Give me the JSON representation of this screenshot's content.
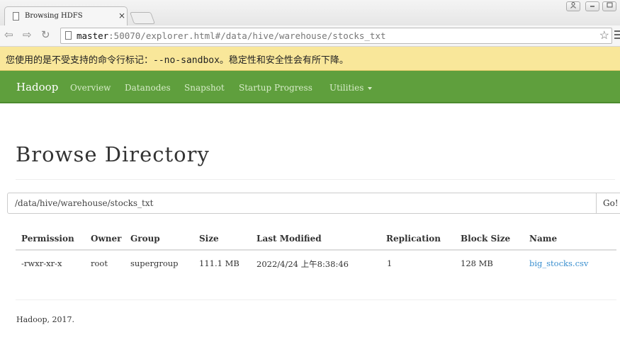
{
  "browser": {
    "tab_title": "Browsing HDFS",
    "tab_close": "×",
    "url_host": "master",
    "url_rest": ":50070/explorer.html#/data/hive/warehouse/stocks_txt",
    "infobar_message": "您使用的是不受支持的命令行标记：--no-sandbox。稳定性和安全性会有所下降。"
  },
  "navbar": {
    "brand": "Hadoop",
    "links": [
      "Overview",
      "Datanodes",
      "Snapshot",
      "Startup Progress",
      "Utilities"
    ]
  },
  "main": {
    "title": "Browse Directory",
    "path_value": "/data/hive/warehouse/stocks_txt",
    "go_label": "Go!",
    "table": {
      "headers": [
        "Permission",
        "Owner",
        "Group",
        "Size",
        "Last Modified",
        "Replication",
        "Block Size",
        "Name"
      ],
      "rows": [
        [
          "-rwxr-xr-x",
          "root",
          "supergroup",
          "111.1 MB",
          "2022/4/24 上午8:38:46",
          "1",
          "128 MB",
          "big_stocks.csv"
        ]
      ]
    },
    "footer": "Hadoop, 2017."
  }
}
